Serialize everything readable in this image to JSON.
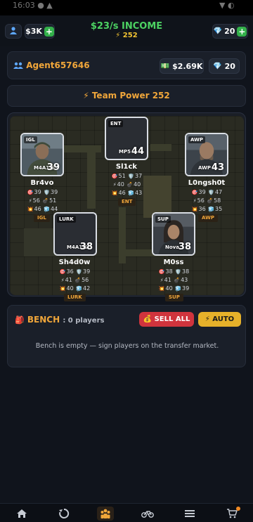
{
  "header": {
    "cash": "$3K",
    "income": "$23/s INCOME",
    "power": "⚡ 252",
    "gems": "20"
  },
  "agent": {
    "name": "Agent657646",
    "money": "$2.69K",
    "gems": "20"
  },
  "team_power": "⚡ Team Power 252",
  "players": [
    {
      "name": "Br4vo",
      "role": "IGL",
      "weapon": "M4A1-S",
      "rating": "39",
      "aim": "39",
      "def": "39",
      "spd": "56",
      "util": "51",
      "clutch": "46",
      "iq": "44"
    },
    {
      "name": "Sl1ck",
      "role": "ENT",
      "weapon": "MP5",
      "rating": "44",
      "aim": "51",
      "def": "37",
      "spd": "40",
      "util": "40",
      "clutch": "46",
      "iq": "43"
    },
    {
      "name": "L0ngsh0t",
      "role": "AWP",
      "weapon": "AWP",
      "rating": "43",
      "aim": "39",
      "def": "47",
      "spd": "56",
      "util": "58",
      "clutch": "36",
      "iq": "35"
    },
    {
      "name": "Sh4d0w",
      "role": "LURK",
      "weapon": "M4A1-S",
      "rating": "38",
      "aim": "36",
      "def": "39",
      "spd": "41",
      "util": "56",
      "clutch": "40",
      "iq": "42"
    },
    {
      "name": "M0ss",
      "role": "SUP",
      "weapon": "Nova",
      "rating": "38",
      "aim": "38",
      "def": "38",
      "spd": "41",
      "util": "43",
      "clutch": "40",
      "iq": "39"
    }
  ],
  "bench": {
    "title": "BENCH",
    "count": ": 0 players",
    "sell_all": "💰 SELL ALL",
    "auto": "⚡ AUTO",
    "empty_message": "Bench is empty — sign players on the transfer market."
  },
  "nav": [
    "home-icon",
    "refresh-icon",
    "team-icon",
    "bike-icon",
    "list-icon",
    "cart-icon"
  ],
  "colors": {
    "accent_orange": "#f0a63a",
    "income_green": "#4cd262",
    "sell_red": "#d0343d",
    "auto_yellow": "#e6b12a",
    "background": "#10141c"
  }
}
